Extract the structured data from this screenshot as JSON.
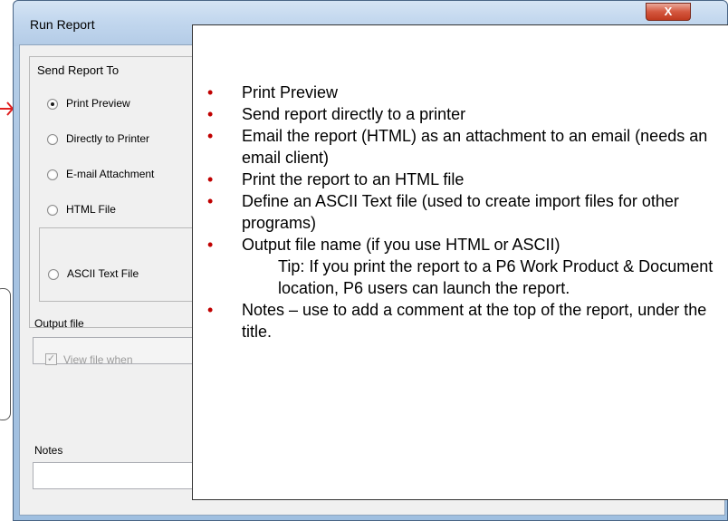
{
  "window": {
    "title": "Run Report",
    "close_label": "X"
  },
  "send_report_to": {
    "legend": "Send Report To",
    "options": [
      {
        "label": "Print Preview",
        "checked": true
      },
      {
        "label": "Directly to Printer",
        "checked": false
      },
      {
        "label": "E-mail Attachment",
        "checked": false
      },
      {
        "label": "HTML File",
        "checked": false
      },
      {
        "label": "ASCII Text File",
        "checked": false
      }
    ]
  },
  "output_file": {
    "label": "Output file",
    "value": ""
  },
  "view_file": {
    "label": "View file when",
    "checked": true
  },
  "notes": {
    "label": "Notes",
    "value": ""
  },
  "callout": {
    "items": [
      "Print Preview",
      "Send report directly to a printer",
      "Email the report (HTML) as an attachment to an email (needs an email client)",
      "Print the report to an HTML file",
      "Define an ASCII Text file (used to create import files for other programs)",
      "Output file name (if you use HTML or ASCII)"
    ],
    "tip": "Tip: If you print the report to a P6 Work Product & Document location, P6 users can launch the report.",
    "last_item": "Notes – use to add a comment at the top of the report, under the title.",
    "bullet_color": "#c00000"
  }
}
